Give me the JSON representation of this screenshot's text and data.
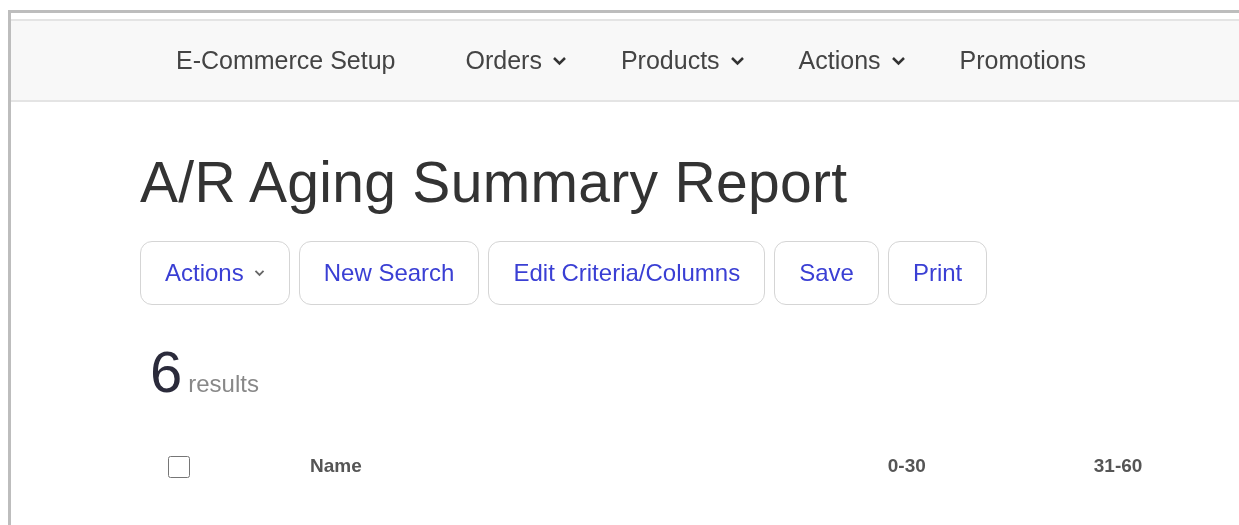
{
  "nav": [
    {
      "label": "E-Commerce Setup",
      "kind": "link"
    },
    {
      "label": "Orders",
      "kind": "dropdown"
    },
    {
      "label": "Products",
      "kind": "dropdown"
    },
    {
      "label": "Actions",
      "kind": "dropdown"
    },
    {
      "label": "Promotions",
      "kind": "link"
    }
  ],
  "title": "A/R Aging Summary Report",
  "buttons": [
    {
      "label": "Actions",
      "kind": "dropdown"
    },
    {
      "label": "New Search",
      "kind": "plain"
    },
    {
      "label": "Edit Criteria/Columns",
      "kind": "plain"
    },
    {
      "label": "Save",
      "kind": "plain"
    },
    {
      "label": "Print",
      "kind": "plain"
    }
  ],
  "result_count": "6",
  "result_label": "results",
  "table": {
    "select_all": {
      "checked": false
    },
    "columns": [
      "Name",
      "0-30",
      "31-60"
    ]
  }
}
